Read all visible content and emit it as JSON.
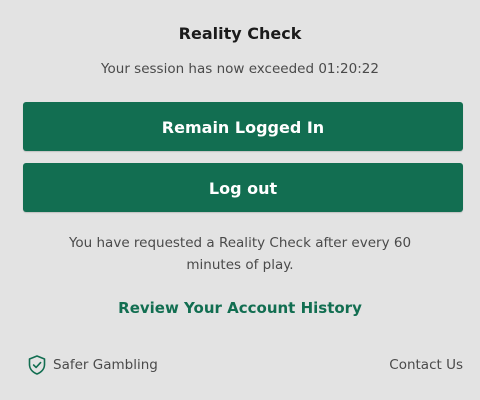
{
  "dialog": {
    "title": "Reality Check",
    "session_message": "Your session has now exceeded 01:20:22",
    "remain_button": "Remain Logged In",
    "logout_button": "Log out",
    "info_text": "You have requested a Reality Check after every 60 minutes of play.",
    "history_link": "Review Your Account History"
  },
  "footer": {
    "safer_gambling": "Safer Gambling",
    "safer_icon": "shield-check-icon",
    "contact": "Contact Us"
  },
  "colors": {
    "background": "#e3e3e3",
    "primary": "#126e51",
    "text": "#4a4a4a"
  }
}
